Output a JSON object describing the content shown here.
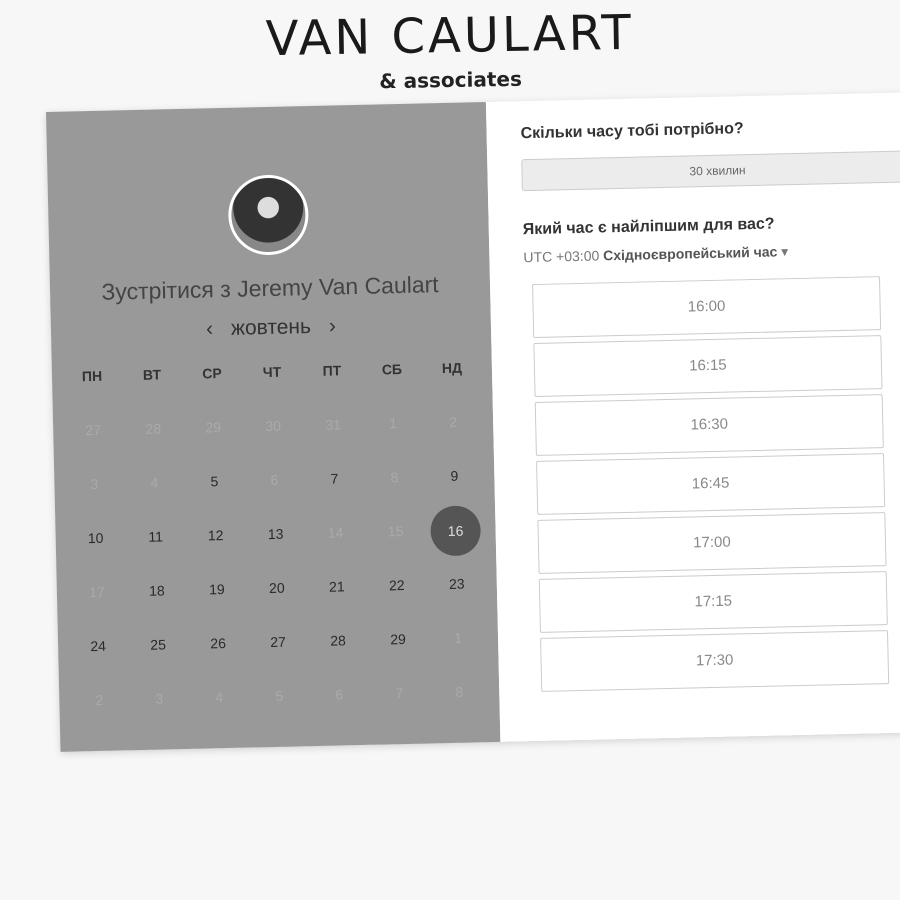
{
  "brand": {
    "name": "VAN CAULART",
    "tagline": "& associates"
  },
  "left": {
    "title": "Зустрітися з Jeremy Van Caulart",
    "month": "жовтень",
    "prev": "‹",
    "next": "›",
    "weekdays": [
      "ПН",
      "ВТ",
      "СР",
      "ЧТ",
      "ПТ",
      "СБ",
      "НД"
    ],
    "days": [
      {
        "d": "27",
        "s": "off"
      },
      {
        "d": "28",
        "s": "off"
      },
      {
        "d": "29",
        "s": "off"
      },
      {
        "d": "30",
        "s": "off"
      },
      {
        "d": "31",
        "s": "off"
      },
      {
        "d": "1",
        "s": "off"
      },
      {
        "d": "2",
        "s": "off"
      },
      {
        "d": "3",
        "s": "off"
      },
      {
        "d": "4",
        "s": "off"
      },
      {
        "d": "5",
        "s": "on"
      },
      {
        "d": "6",
        "s": "off"
      },
      {
        "d": "7",
        "s": "on"
      },
      {
        "d": "8",
        "s": "off"
      },
      {
        "d": "9",
        "s": "on"
      },
      {
        "d": "10",
        "s": "on"
      },
      {
        "d": "11",
        "s": "on"
      },
      {
        "d": "12",
        "s": "on"
      },
      {
        "d": "13",
        "s": "on"
      },
      {
        "d": "14",
        "s": "off"
      },
      {
        "d": "15",
        "s": "off"
      },
      {
        "d": "16",
        "s": "sel"
      },
      {
        "d": "17",
        "s": "off"
      },
      {
        "d": "18",
        "s": "on"
      },
      {
        "d": "19",
        "s": "on"
      },
      {
        "d": "20",
        "s": "on"
      },
      {
        "d": "21",
        "s": "on"
      },
      {
        "d": "22",
        "s": "on"
      },
      {
        "d": "23",
        "s": "on"
      },
      {
        "d": "24",
        "s": "on"
      },
      {
        "d": "25",
        "s": "on"
      },
      {
        "d": "26",
        "s": "on"
      },
      {
        "d": "27",
        "s": "on"
      },
      {
        "d": "28",
        "s": "on"
      },
      {
        "d": "29",
        "s": "on"
      },
      {
        "d": "1",
        "s": "off"
      },
      {
        "d": "2",
        "s": "off"
      },
      {
        "d": "3",
        "s": "off"
      },
      {
        "d": "4",
        "s": "off"
      },
      {
        "d": "5",
        "s": "off"
      },
      {
        "d": "6",
        "s": "off"
      },
      {
        "d": "7",
        "s": "off"
      },
      {
        "d": "8",
        "s": "off"
      }
    ]
  },
  "right": {
    "duration_q": "Скільки часу тобі потрібно?",
    "duration": "30 хвилин",
    "time_q": "Який час є найліпшим для вас?",
    "tz_offset": "UTC +03:00",
    "tz_name": "Східноєвропейський час",
    "tz_caret": "▾",
    "slots": [
      "16:00",
      "16:15",
      "16:30",
      "16:45",
      "17:00",
      "17:15",
      "17:30",
      ""
    ]
  }
}
